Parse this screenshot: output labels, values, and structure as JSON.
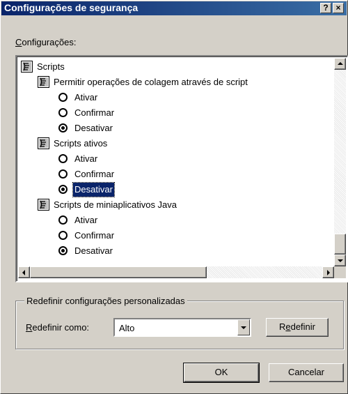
{
  "window": {
    "title": "Configurações de segurança",
    "help_glyph": "?",
    "close_glyph": "×"
  },
  "settings_label": {
    "mnemonic": "C",
    "rest": "onfigurações:"
  },
  "tree": {
    "root": {
      "label": "Scripts",
      "icon": "script-settings-icon"
    },
    "groups": [
      {
        "label": "Permitir operações de colagem através de script",
        "icon": "script-settings-icon",
        "options": [
          {
            "label": "Ativar",
            "checked": false,
            "selected": false
          },
          {
            "label": "Confirmar",
            "checked": false,
            "selected": false
          },
          {
            "label": "Desativar",
            "checked": true,
            "selected": false
          }
        ]
      },
      {
        "label": "Scripts ativos",
        "icon": "script-settings-icon",
        "options": [
          {
            "label": "Ativar",
            "checked": false,
            "selected": false
          },
          {
            "label": "Confirmar",
            "checked": false,
            "selected": false
          },
          {
            "label": "Desativar",
            "checked": true,
            "selected": true
          }
        ]
      },
      {
        "label": "Scripts de miniaplicativos Java",
        "icon": "script-settings-icon",
        "options": [
          {
            "label": "Ativar",
            "checked": false,
            "selected": false
          },
          {
            "label": "Confirmar",
            "checked": false,
            "selected": false
          },
          {
            "label": "Desativar",
            "checked": true,
            "selected": false
          }
        ]
      }
    ]
  },
  "reset_group": {
    "title": "Redefinir configurações personalizadas",
    "label_mnemonic": "R",
    "label_rest": "edefinir como:",
    "combo_value": "Alto",
    "reset_button_mnemonic": "e",
    "reset_button_pre": "R",
    "reset_button_rest": "definir"
  },
  "buttons": {
    "ok": "OK",
    "cancel": "Cancelar"
  },
  "colors": {
    "title_bar": "#0a246a",
    "face": "#d4d0c8",
    "selection": "#0a246a"
  }
}
